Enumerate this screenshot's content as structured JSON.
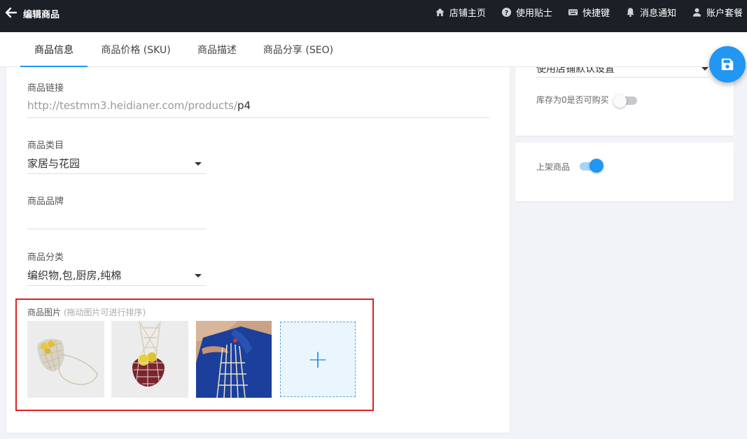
{
  "header": {
    "back_icon": "arrow-left-icon",
    "title": "编辑商品",
    "nav": [
      {
        "label": "店铺主页",
        "icon": "home-icon"
      },
      {
        "label": "使用贴士",
        "icon": "help-circle-icon"
      },
      {
        "label": "快捷键",
        "icon": "keyboard-icon"
      },
      {
        "label": "消息通知",
        "icon": "bell-icon"
      },
      {
        "label": "账户套餐",
        "icon": "user-icon"
      }
    ]
  },
  "tabs": [
    {
      "label": "商品信息",
      "active": true
    },
    {
      "label": "商品价格 (SKU)",
      "active": false
    },
    {
      "label": "商品描述",
      "active": false
    },
    {
      "label": "商品分享 (SEO)",
      "active": false
    }
  ],
  "form": {
    "link": {
      "label": "商品链接",
      "prefix": "http://testmm3.heidianer.com/products/",
      "value": "p4"
    },
    "category": {
      "label": "商品类目",
      "value": "家居与花园"
    },
    "brand": {
      "label": "商品品牌",
      "value": ""
    },
    "classification": {
      "label": "商品分类",
      "value": "编织物,包,厨房,纯棉"
    },
    "images": {
      "label": "商品图片",
      "hint": "(拖动图片可进行排序)",
      "count": 3,
      "add_icon": "plus-icon",
      "add_symbol": "+"
    }
  },
  "right": {
    "stock_select_value": "使用店铺默认设置",
    "zero_stock": {
      "label": "库存为0是否可购买",
      "on": false
    },
    "publish": {
      "label": "上架商品",
      "on": true
    }
  },
  "fab": {
    "icon": "save-icon"
  },
  "colors": {
    "accent": "#2196f3",
    "highlight": "#e02020",
    "topbar": "#1b1f26"
  }
}
